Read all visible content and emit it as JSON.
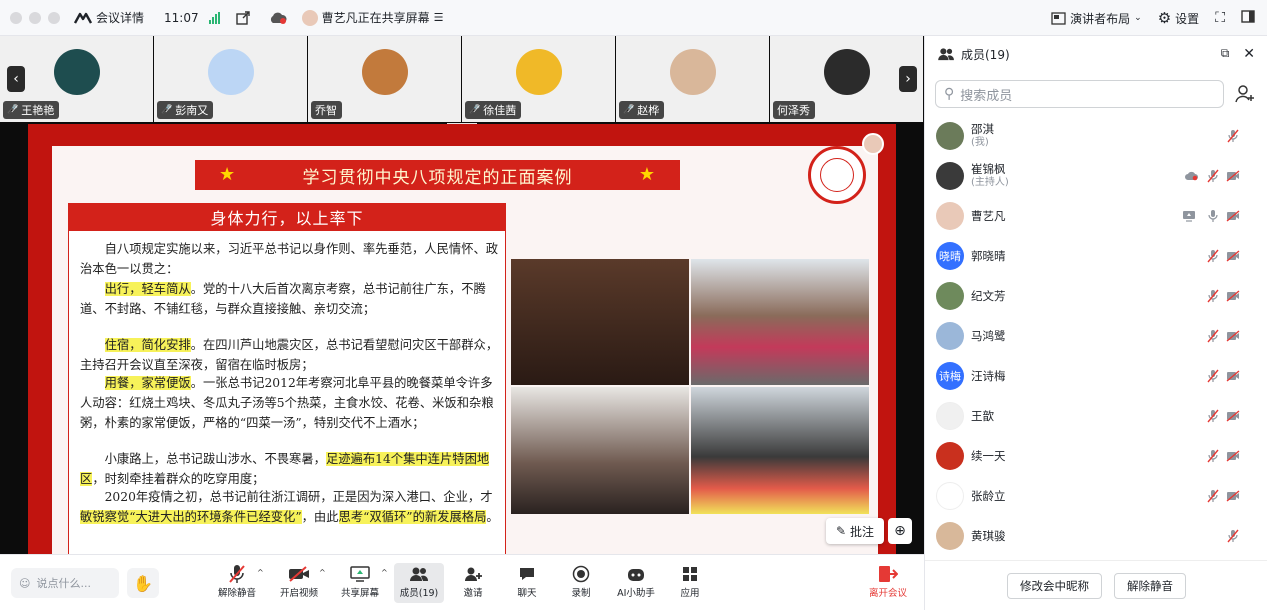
{
  "topbar": {
    "meeting_details": "会议详情",
    "time": "11:07",
    "sharing_text": "曹艺凡正在共享屏幕",
    "presenter_layout": "演讲者布局",
    "settings": "设置"
  },
  "gallery": {
    "participants": [
      {
        "name": "王艳艳",
        "muted": true,
        "color": "#1e4d4f"
      },
      {
        "name": "彭南又",
        "muted": true,
        "color": "#bcd6f5"
      },
      {
        "name": "乔智",
        "muted": false,
        "color": "#c27a3c"
      },
      {
        "name": "徐佳茜",
        "muted": true,
        "color": "#f0b928"
      },
      {
        "name": "赵桦",
        "muted": true,
        "color": "#d9b79a"
      },
      {
        "name": "何泽秀",
        "muted": false,
        "color": "#2b2b2b"
      }
    ]
  },
  "slide": {
    "title": "学习贯彻中央八项规定的正面案例",
    "subtitle": "身体力行，以上率下",
    "p1": "自八项规定实施以来，习近平总书记以身作则、率先垂范，人民情怀、政治本色一以贯之：",
    "p2_hl": "出行，轻车简从",
    "p2": "。党的十八大后首次离京考察，总书记前往广东，不腾道、不封路、不铺红毯，与群众直接接触、亲切交流；",
    "p3_hl": "住宿，简化安排",
    "p3": "。在四川芦山地震灾区，总书记看望慰问灾区干部群众，主持召开会议直至深夜，留宿在临时板房；",
    "p4_hl": "用餐，家常便饭",
    "p4": "。一张总书记2012年考察河北阜平县的晚餐菜单令许多人动容：红烧土鸡块、冬瓜丸子汤等5个热菜，主食水饺、花卷、米饭和杂粮粥，朴素的家常便饭，严格的“四菜一汤”，特别交代不上酒水；",
    "p5a": "小康路上，总书记跋山涉水、不畏寒暑，",
    "p5_hl": "足迹遍布14个集中连片特困地区",
    "p5b": "，时刻牵挂着群众的吃穿用度；",
    "p6a": "2020年疫情之初，总书记前往浙江调研，正是因为深入港口、企业，才",
    "p6_hl": "敏锐察觉“大进大出的环境条件已经变化”",
    "p6b": "，由此",
    "p6_hl2": "思考“双循环”的新发展格局",
    "p6c": "。"
  },
  "annotation_label": "批注",
  "bottom": {
    "say_placeholder": "说点什么...",
    "tools": [
      {
        "label": "解除静音"
      },
      {
        "label": "开启视频"
      },
      {
        "label": "共享屏幕"
      },
      {
        "label": "成员(19)"
      },
      {
        "label": "邀请"
      },
      {
        "label": "聊天"
      },
      {
        "label": "录制"
      },
      {
        "label": "AI小助手"
      },
      {
        "label": "应用"
      }
    ],
    "leave": "离开会议"
  },
  "panel": {
    "title": "成员(19)",
    "search_placeholder": "搜索成员",
    "members": [
      {
        "name": "邵淇",
        "sub": "(我)",
        "avatar": "",
        "color": "#6b7b5a",
        "cam": false,
        "video": false,
        "mic": "off"
      },
      {
        "name": "崔锦枫",
        "sub": "(主持人)",
        "avatar": "",
        "color": "#3a3a3a",
        "cam": true,
        "video": true,
        "mic": "off"
      },
      {
        "name": "曹艺凡",
        "sub": "",
        "avatar": "",
        "color": "#e9c9b8",
        "cam": false,
        "video": true,
        "mic": "on",
        "share": true
      },
      {
        "name": "郭晓晴",
        "sub": "",
        "avatar": "晓晴",
        "color": "#3370ff",
        "cam": false,
        "video": true,
        "mic": "off"
      },
      {
        "name": "纪文芳",
        "sub": "",
        "avatar": "",
        "color": "#6e8a5c",
        "cam": false,
        "video": true,
        "mic": "off"
      },
      {
        "name": "马鸿鹭",
        "sub": "",
        "avatar": "",
        "color": "#9bb7d9",
        "cam": false,
        "video": true,
        "mic": "off"
      },
      {
        "name": "汪诗梅",
        "sub": "",
        "avatar": "诗梅",
        "color": "#3370ff",
        "cam": false,
        "video": true,
        "mic": "off"
      },
      {
        "name": "王歆",
        "sub": "",
        "avatar": "",
        "color": "#f0f0f0",
        "cam": false,
        "video": true,
        "mic": "off"
      },
      {
        "name": "续一天",
        "sub": "",
        "avatar": "",
        "color": "#c9301e",
        "cam": false,
        "video": true,
        "mic": "off"
      },
      {
        "name": "张龄立",
        "sub": "",
        "avatar": "",
        "color": "#ffffff",
        "cam": false,
        "video": true,
        "mic": "off"
      },
      {
        "name": "黄琪骏",
        "sub": "",
        "avatar": "",
        "color": "#d8b89a",
        "cam": false,
        "video": false,
        "mic": "off"
      }
    ],
    "rename_button": "修改会中昵称",
    "unmute_button": "解除静音"
  }
}
